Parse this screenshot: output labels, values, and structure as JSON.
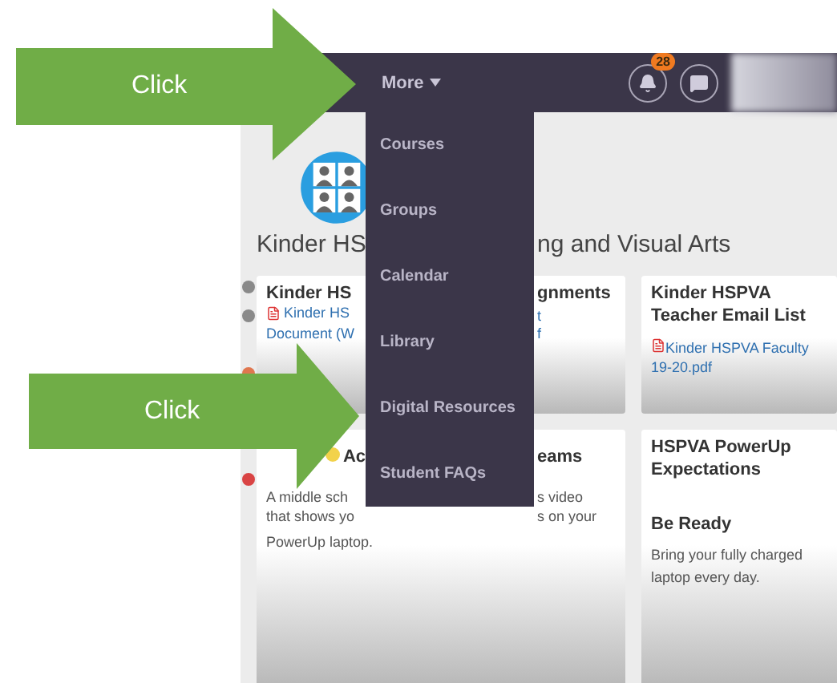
{
  "nav": {
    "more_label": "More",
    "notification_count": "28"
  },
  "menu": {
    "items": [
      "Courses",
      "Groups",
      "Calendar",
      "Library",
      "Digital Resources",
      "Student FAQs"
    ]
  },
  "page_title": {
    "left": "Kinder HS",
    "right": "ng and Visual Arts"
  },
  "left_cards": [
    {
      "kind": "links",
      "title": {
        "left": "Kinder HS",
        "right": "gnments"
      },
      "lines": [
        {
          "left": "Kinder HS",
          "right": "t",
          "icon": true
        },
        {
          "left": "Document (W",
          "right": "f",
          "icon": false
        }
      ]
    },
    {
      "kind": "text",
      "title": {
        "left": "Ac",
        "right": "eams"
      },
      "lines": [
        {
          "left": "A middle sch",
          "right": "s video"
        },
        {
          "left": "that shows yo",
          "right": "s on your"
        }
      ],
      "full_line": "PowerUp laptop."
    }
  ],
  "right_cards": [
    {
      "kind": "links",
      "title": "Kinder HSPVA Teacher Email List",
      "link": "Kinder HSPVA Faculty 19-20.pdf"
    },
    {
      "kind": "text",
      "title": "HSPVA PowerUp Expectations",
      "subtitle": "Be Ready",
      "text": "Bring your fully charged laptop every day."
    }
  ],
  "callouts": [
    {
      "label": "Click"
    },
    {
      "label": "Click"
    }
  ]
}
